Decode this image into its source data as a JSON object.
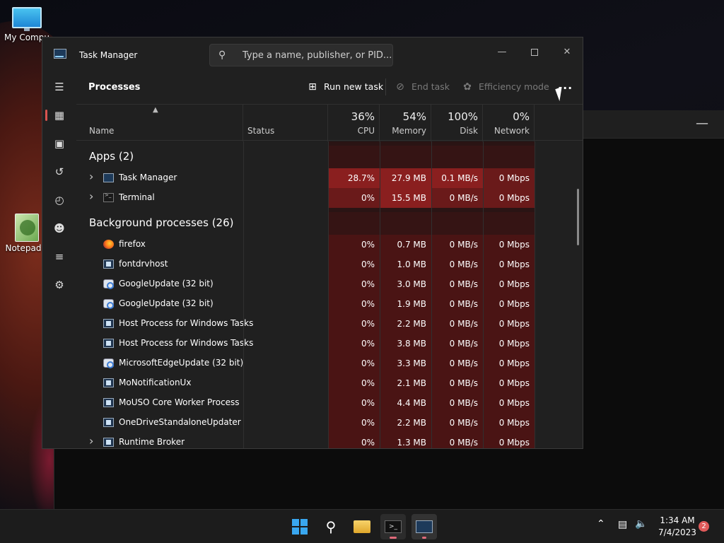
{
  "desktop": {
    "icons": [
      {
        "label": "My Compu",
        "icon": "computer-icon"
      },
      {
        "label": "Notepad+",
        "icon": "notepad-icon"
      }
    ]
  },
  "window": {
    "title": "Task Manager",
    "search_placeholder": "Type a name, publisher, or PID...",
    "minimize": "—",
    "close": "✕"
  },
  "sidebar": {
    "items": [
      "menu",
      "processes",
      "performance",
      "app-history",
      "startup-apps",
      "users",
      "details",
      "services",
      "settings"
    ]
  },
  "toolbar": {
    "page_title": "Processes",
    "run_new_task": "Run new task",
    "end_task": "End task",
    "efficiency_mode": "Efficiency mode",
    "more": "..."
  },
  "columns": {
    "name": "Name",
    "status": "Status",
    "cpu": {
      "pct": "36%",
      "label": "CPU"
    },
    "memory": {
      "pct": "54%",
      "label": "Memory"
    },
    "disk": {
      "pct": "100%",
      "label": "Disk"
    },
    "network": {
      "pct": "0%",
      "label": "Network"
    }
  },
  "groups": {
    "apps": "Apps (2)",
    "background": "Background processes (26)"
  },
  "apps": [
    {
      "name": "Task Manager",
      "icon": "task-manager-icon",
      "expandable": true,
      "cpu": "28.7%",
      "memory": "27.9 MB",
      "disk": "0.1 MB/s",
      "network": "0 Mbps"
    },
    {
      "name": "Terminal",
      "icon": "terminal-icon",
      "expandable": true,
      "cpu": "0%",
      "memory": "15.5 MB",
      "disk": "0 MB/s",
      "network": "0 Mbps"
    }
  ],
  "background": [
    {
      "name": "firefox",
      "icon": "firefox-icon",
      "expandable": false,
      "cpu": "0%",
      "memory": "0.7 MB",
      "disk": "0 MB/s",
      "network": "0 Mbps"
    },
    {
      "name": "fontdrvhost",
      "icon": "window-app-icon",
      "expandable": false,
      "cpu": "0%",
      "memory": "1.0 MB",
      "disk": "0 MB/s",
      "network": "0 Mbps"
    },
    {
      "name": "GoogleUpdate (32 bit)",
      "icon": "update-icon",
      "expandable": false,
      "cpu": "0%",
      "memory": "3.0 MB",
      "disk": "0 MB/s",
      "network": "0 Mbps"
    },
    {
      "name": "GoogleUpdate (32 bit)",
      "icon": "update-icon",
      "expandable": false,
      "cpu": "0%",
      "memory": "1.9 MB",
      "disk": "0 MB/s",
      "network": "0 Mbps"
    },
    {
      "name": "Host Process for Windows Tasks",
      "icon": "window-app-icon",
      "expandable": false,
      "cpu": "0%",
      "memory": "2.2 MB",
      "disk": "0 MB/s",
      "network": "0 Mbps"
    },
    {
      "name": "Host Process for Windows Tasks",
      "icon": "window-app-icon",
      "expandable": false,
      "cpu": "0%",
      "memory": "3.8 MB",
      "disk": "0 MB/s",
      "network": "0 Mbps"
    },
    {
      "name": "MicrosoftEdgeUpdate (32 bit)",
      "icon": "update-icon",
      "expandable": false,
      "cpu": "0%",
      "memory": "3.3 MB",
      "disk": "0 MB/s",
      "network": "0 Mbps"
    },
    {
      "name": "MoNotificationUx",
      "icon": "window-app-icon",
      "expandable": false,
      "cpu": "0%",
      "memory": "2.1 MB",
      "disk": "0 MB/s",
      "network": "0 Mbps"
    },
    {
      "name": "MoUSO Core Worker Process",
      "icon": "window-app-icon",
      "expandable": false,
      "cpu": "0%",
      "memory": "4.4 MB",
      "disk": "0 MB/s",
      "network": "0 Mbps"
    },
    {
      "name": "OneDriveStandaloneUpdater",
      "icon": "window-app-icon",
      "expandable": false,
      "cpu": "0%",
      "memory": "2.2 MB",
      "disk": "0 MB/s",
      "network": "0 Mbps"
    },
    {
      "name": "Runtime Broker",
      "icon": "window-app-icon",
      "expandable": true,
      "cpu": "0%",
      "memory": "1.3 MB",
      "disk": "0 MB/s",
      "network": "0 Mbps"
    }
  ],
  "taskbar": {
    "clock_time": "1:34 AM",
    "clock_date": "7/4/2023",
    "notification_count": "2"
  },
  "colors": {
    "heat_low": "#4a1414",
    "heat_mid": "#6a1a1a",
    "heat_high": "#8a1f1f",
    "accent": "#d9534f"
  }
}
